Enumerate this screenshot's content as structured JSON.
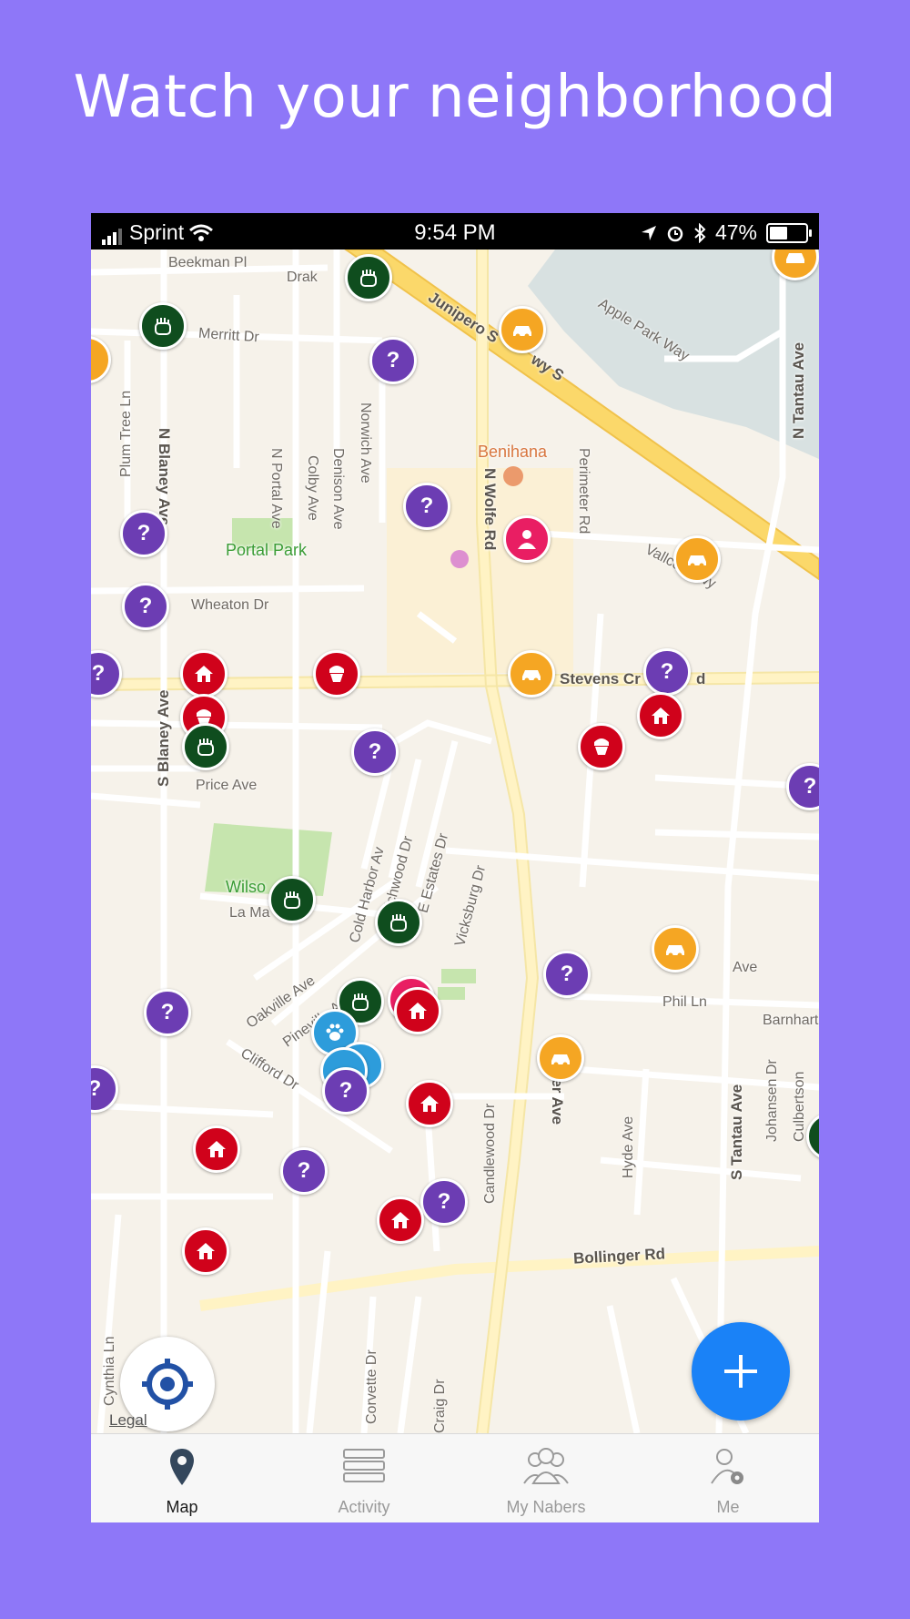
{
  "promo": {
    "title": "Watch your neighborhood"
  },
  "status_bar": {
    "carrier": "Sprint",
    "time": "9:54 PM",
    "battery": "47%"
  },
  "map": {
    "streets": [
      "Beekman Pl",
      "Merritt Dr",
      "Plum Tree Ln",
      "N Blaney Ave",
      "N Portal Ave",
      "Colby Ave",
      "Denison Ave",
      "Norwich Ave",
      "N Wolfe Rd",
      "Perimeter Rd",
      "Apple Park Way",
      "N Tantau Ave",
      "Vallco Pkwy",
      "Wheaton Dr",
      "Stevens Cr",
      "S Blaney Ave",
      "Price Ave",
      "Cold Harbor Av",
      "Richwood Dr",
      "E Estates Dr",
      "Vicksburg Dr",
      "Oakville Ave",
      "Pineville Ave",
      "Clifford Dr",
      "Miller Ave",
      "Phil Ln",
      "Barnhart",
      "Candlewood Dr",
      "Hyde Ave",
      "S Tantau Ave",
      "Johansen Dr",
      "Culbertson",
      "Bollinger Rd",
      "Cynthia Ln",
      "Corvette Dr",
      "Craig Dr",
      "Junipero S",
      "wy S",
      "La Ma",
      "Ave",
      "Drak",
      "d"
    ],
    "pois": {
      "park1": "Portal Park",
      "park2": "Wilso",
      "restaurant": "Benihana"
    },
    "legal": "Legal",
    "pin_question_glyph": "?"
  },
  "tabs": [
    {
      "label": "Map",
      "icon": "map-pin-icon"
    },
    {
      "label": "Activity",
      "icon": "list-icon"
    },
    {
      "label": "My Nabers",
      "icon": "people-icon"
    },
    {
      "label": "Me",
      "icon": "user-settings-icon"
    }
  ],
  "colors": {
    "background": "#8e77f8",
    "accent": "#1a82f7",
    "pin_question": "#6c3db3",
    "pin_home": "#d0021b",
    "pin_car": "#f5a623",
    "pin_burglar": "#0f4d1e",
    "pin_person": "#e91e63",
    "pin_pet": "#2d9cdb"
  }
}
